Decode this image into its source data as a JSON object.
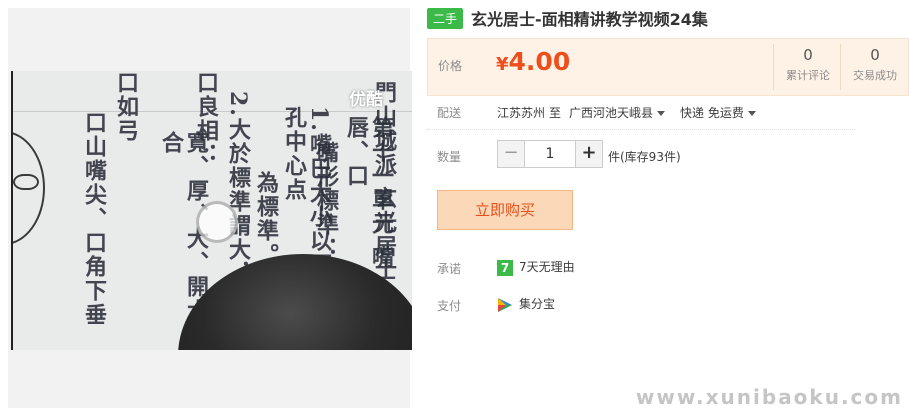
{
  "product": {
    "condition_tag": "二手",
    "title": "玄光居士-面相精讲教学视频24集"
  },
  "media": {
    "player_watermark": "优酷",
    "board_columns": [
      "門山城派 玄光居士",
      "第十一單元 嘴唇、口",
      "嘴形標準：",
      "1.嘴巴大小以兩眼瞳孔中心点",
      "為標準。",
      "2.大於標準謂大，",
      "口良相：",
      "寬、厚、大、開大合",
      "口如弓",
      "口山嘴尖、口角下垂"
    ]
  },
  "price": {
    "label": "价格",
    "currency": "¥",
    "value": "4.00",
    "reviews_count": "0",
    "reviews_label": "累计评论",
    "deals_count": "0",
    "deals_label": "交易成功"
  },
  "delivery": {
    "label": "配送",
    "from": "江苏苏州",
    "to_word": "至",
    "to": "广西河池天峨县",
    "method": "快递 免运费"
  },
  "quantity": {
    "label": "数量",
    "value": "1",
    "minus": "−",
    "plus": "+",
    "stock_text": "件(库存93件)"
  },
  "buy_button": "立即购买",
  "promise": {
    "label": "承诺",
    "icon_text": "7",
    "text": "7天无理由"
  },
  "payment": {
    "label": "支付",
    "text": "集分宝"
  },
  "site_watermark": "www.xunibaoku.com",
  "colors": {
    "accent_price": "#ee4d1c",
    "tag_green": "#3bb949",
    "buy_bg": "#fbd9b8"
  }
}
